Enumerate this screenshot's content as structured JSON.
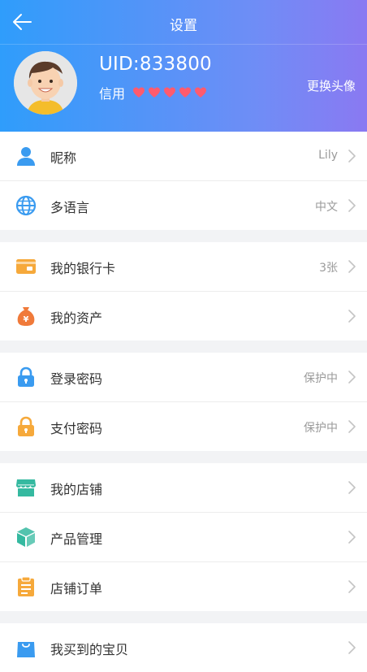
{
  "header": {
    "title": "设置",
    "uid": "UID:833800",
    "credit_label": "信用",
    "credit_hearts": 5,
    "change_avatar": "更换头像",
    "heart_color": "#ff5b6e"
  },
  "groups": [
    {
      "items": [
        {
          "name": "nickname",
          "label": "昵称",
          "value": "Lily",
          "icon": "user-icon",
          "color": "#3a9bf0"
        },
        {
          "name": "language",
          "label": "多语言",
          "value": "中文",
          "icon": "globe-icon",
          "color": "#3a9bf0"
        }
      ]
    },
    {
      "items": [
        {
          "name": "bank-card",
          "label": "我的银行卡",
          "value": "3张",
          "icon": "card-icon",
          "color": "#f6a93b"
        },
        {
          "name": "assets",
          "label": "我的资产",
          "value": "",
          "icon": "money-bag-icon",
          "color": "#f07a3a"
        }
      ]
    },
    {
      "items": [
        {
          "name": "login-password",
          "label": "登录密码",
          "value": "保护中",
          "icon": "lock-icon",
          "color": "#3a9bf0"
        },
        {
          "name": "pay-password",
          "label": "支付密码",
          "value": "保护中",
          "icon": "lock-icon",
          "color": "#f6a93b"
        }
      ]
    },
    {
      "items": [
        {
          "name": "my-shop",
          "label": "我的店铺",
          "value": "",
          "icon": "shop-icon",
          "color": "#35b9a0"
        },
        {
          "name": "product-management",
          "label": "产品管理",
          "value": "",
          "icon": "box-icon",
          "color": "#35b9a0"
        },
        {
          "name": "shop-orders",
          "label": "店铺订单",
          "value": "",
          "icon": "clipboard-icon",
          "color": "#f6a93b"
        }
      ]
    },
    {
      "items": [
        {
          "name": "purchased",
          "label": "我买到的宝贝",
          "value": "",
          "icon": "bag-icon",
          "color": "#3a9bf0"
        }
      ]
    }
  ]
}
